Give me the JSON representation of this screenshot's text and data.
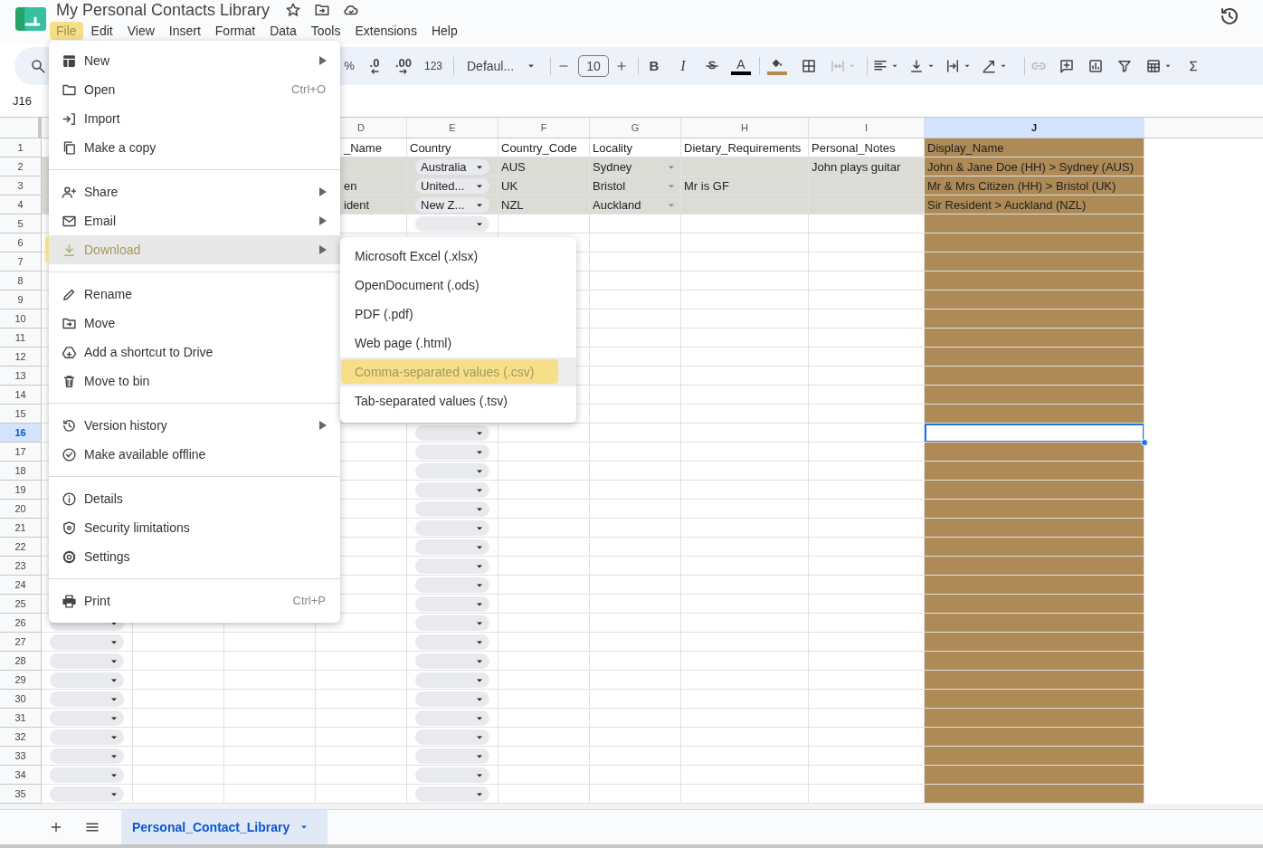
{
  "header": {
    "title": "My Personal Contacts Library"
  },
  "menubar": [
    {
      "label": "File",
      "selected": true
    },
    {
      "label": "Edit",
      "selected": false
    },
    {
      "label": "View",
      "selected": false
    },
    {
      "label": "Insert",
      "selected": false
    },
    {
      "label": "Format",
      "selected": false
    },
    {
      "label": "Data",
      "selected": false
    },
    {
      "label": "Tools",
      "selected": false
    },
    {
      "label": "Extensions",
      "selected": false
    },
    {
      "label": "Help",
      "selected": false
    }
  ],
  "toolbar": {
    "percent": "%",
    "decrease_decimal": ".0",
    "increase_decimal": ".00",
    "number_format": "123",
    "font": "Defaul...",
    "font_size": "10",
    "bold": "B",
    "italic": "I",
    "text_color": {
      "label": "A",
      "color": "#000000"
    },
    "fill_color": {
      "color": "#b8894f"
    },
    "merge": {
      "disabled": true
    },
    "link": {
      "disabled": true
    }
  },
  "name_box": "J16",
  "grid": {
    "columns": [
      {
        "label": "D",
        "selected": false
      },
      {
        "label": "E",
        "selected": false
      },
      {
        "label": "F",
        "selected": false
      },
      {
        "label": "G",
        "selected": false
      },
      {
        "label": "H",
        "selected": false
      },
      {
        "label": "I",
        "selected": false
      },
      {
        "label": "J",
        "selected": true,
        "color": "#ad8a56"
      }
    ],
    "rows": [
      {
        "number": "1",
        "selected": false,
        "shaded": false,
        "cells": [
          null,
          null,
          null,
          {
            "text": "_Name"
          },
          {
            "text": "Country"
          },
          {
            "text": "Country_Code"
          },
          {
            "text": "Locality"
          },
          {
            "text": "Dietary_Requirements"
          },
          {
            "text": "Personal_Notes"
          },
          {
            "text": "Display_Name"
          }
        ]
      },
      {
        "number": "2",
        "selected": false,
        "shaded": true,
        "cells": [
          null,
          null,
          null,
          null,
          {
            "kind": "chip",
            "text": "Australia"
          },
          {
            "text": "AUS"
          },
          {
            "kind": "arrow",
            "text": "Sydney"
          },
          null,
          {
            "text": "John plays guitar"
          },
          {
            "text": "John & Jane Doe (HH) > Sydney (AUS)"
          }
        ]
      },
      {
        "number": "3",
        "selected": false,
        "shaded": true,
        "cells": [
          null,
          null,
          null,
          {
            "text": "en"
          },
          {
            "kind": "chip",
            "text": "United..."
          },
          {
            "text": "UK"
          },
          {
            "kind": "arrow",
            "text": "Bristol"
          },
          {
            "text": "Mr is GF"
          },
          null,
          {
            "text": "Mr & Mrs Citizen (HH) > Bristol (UK)"
          }
        ]
      },
      {
        "number": "4",
        "selected": false,
        "shaded": true,
        "cells": [
          null,
          null,
          null,
          {
            "text": "ident"
          },
          {
            "kind": "chip",
            "text": "New Z..."
          },
          {
            "text": "NZL"
          },
          {
            "kind": "arrow",
            "text": "Auckland"
          },
          null,
          null,
          {
            "text": "Sir Resident > Auckland (NZL)"
          }
        ]
      },
      {
        "number": "5",
        "selected": false,
        "shaded": false,
        "cells": [
          null,
          null,
          null,
          null,
          {
            "kind": "chip"
          }
        ]
      },
      {
        "number": "6",
        "selected": false,
        "shaded": false
      },
      {
        "number": "7",
        "selected": false,
        "shaded": false
      },
      {
        "number": "8",
        "selected": false,
        "shaded": false
      },
      {
        "number": "9",
        "selected": false,
        "shaded": false
      },
      {
        "number": "10",
        "selected": false,
        "shaded": false
      },
      {
        "number": "11",
        "selected": false,
        "shaded": false
      },
      {
        "number": "12",
        "selected": false,
        "shaded": false
      },
      {
        "number": "13",
        "selected": false,
        "shaded": false
      },
      {
        "number": "14",
        "selected": false,
        "shaded": false
      },
      {
        "number": "15",
        "selected": false,
        "shaded": false
      },
      {
        "number": "16",
        "selected": true,
        "shaded": false,
        "cells": [
          null,
          null,
          null,
          null,
          {
            "kind": "chip"
          }
        ]
      },
      {
        "number": "17",
        "selected": false,
        "shaded": false,
        "cells": [
          null,
          null,
          null,
          null,
          {
            "kind": "chip"
          }
        ]
      },
      {
        "number": "18",
        "selected": false,
        "shaded": false,
        "cells": [
          null,
          null,
          null,
          null,
          {
            "kind": "chip"
          }
        ]
      },
      {
        "number": "19",
        "selected": false,
        "shaded": false,
        "cells": [
          null,
          null,
          null,
          null,
          {
            "kind": "chip"
          }
        ]
      },
      {
        "number": "20",
        "selected": false,
        "shaded": false,
        "cells": [
          null,
          null,
          null,
          null,
          {
            "kind": "chip"
          }
        ]
      },
      {
        "number": "21",
        "selected": false,
        "shaded": false,
        "cells": [
          null,
          null,
          null,
          null,
          {
            "kind": "chip"
          }
        ]
      },
      {
        "number": "22",
        "selected": false,
        "shaded": false,
        "cells": [
          null,
          null,
          null,
          null,
          {
            "kind": "chip"
          }
        ]
      },
      {
        "number": "23",
        "selected": false,
        "shaded": false,
        "cells": [
          null,
          null,
          null,
          null,
          {
            "kind": "chip"
          }
        ]
      },
      {
        "number": "24",
        "selected": false,
        "shaded": false,
        "cells": [
          null,
          null,
          null,
          null,
          {
            "kind": "chip"
          }
        ]
      },
      {
        "number": "25",
        "selected": false,
        "shaded": false,
        "cells": [
          null,
          null,
          null,
          null,
          {
            "kind": "chip"
          }
        ]
      },
      {
        "number": "26",
        "selected": false,
        "shaded": false,
        "cells": [
          {
            "kind": "chip"
          },
          null,
          null,
          null,
          {
            "kind": "chip"
          }
        ]
      },
      {
        "number": "27",
        "selected": false,
        "shaded": false,
        "cells": [
          {
            "kind": "chip"
          },
          null,
          null,
          null,
          {
            "kind": "chip"
          }
        ]
      },
      {
        "number": "28",
        "selected": false,
        "shaded": false,
        "cells": [
          {
            "kind": "chip"
          },
          null,
          null,
          null,
          {
            "kind": "chip"
          }
        ]
      },
      {
        "number": "29",
        "selected": false,
        "shaded": false,
        "cells": [
          {
            "kind": "chip"
          },
          null,
          null,
          null,
          {
            "kind": "chip"
          }
        ]
      },
      {
        "number": "30",
        "selected": false,
        "shaded": false,
        "cells": [
          {
            "kind": "chip"
          },
          null,
          null,
          null,
          {
            "kind": "chip"
          }
        ]
      },
      {
        "number": "31",
        "selected": false,
        "shaded": false,
        "cells": [
          {
            "kind": "chip"
          },
          null,
          null,
          null,
          {
            "kind": "chip"
          }
        ]
      },
      {
        "number": "32",
        "selected": false,
        "shaded": false,
        "cells": [
          {
            "kind": "chip"
          },
          null,
          null,
          null,
          {
            "kind": "chip"
          }
        ]
      },
      {
        "number": "33",
        "selected": false,
        "shaded": false,
        "cells": [
          {
            "kind": "chip"
          },
          null,
          null,
          null,
          {
            "kind": "chip"
          }
        ]
      },
      {
        "number": "34",
        "selected": false,
        "shaded": false,
        "cells": [
          {
            "kind": "chip"
          },
          null,
          null,
          null,
          {
            "kind": "chip"
          }
        ]
      },
      {
        "number": "35",
        "selected": false,
        "shaded": false,
        "cells": [
          {
            "kind": "chip"
          },
          null,
          null,
          null,
          {
            "kind": "chip"
          }
        ]
      }
    ]
  },
  "sheet_tabs": [
    {
      "label": "Personal_Contact_Library",
      "selected": true
    }
  ],
  "file_menu": {
    "items": [
      {
        "kind": "item",
        "label": "New",
        "submenu": true,
        "selected": false
      },
      {
        "kind": "item",
        "label": "Open",
        "shortcut": "Ctrl+O",
        "selected": false
      },
      {
        "kind": "item",
        "label": "Import",
        "selected": false
      },
      {
        "kind": "item",
        "label": "Make a copy",
        "selected": false
      },
      {
        "kind": "divider"
      },
      {
        "kind": "item",
        "label": "Share",
        "submenu": true,
        "selected": false
      },
      {
        "kind": "item",
        "label": "Email",
        "submenu": true,
        "selected": false
      },
      {
        "kind": "item",
        "label": "Download",
        "submenu": true,
        "selected": true
      },
      {
        "kind": "divider"
      },
      {
        "kind": "item",
        "label": "Rename",
        "selected": false
      },
      {
        "kind": "item",
        "label": "Move",
        "selected": false
      },
      {
        "kind": "item",
        "label": "Add a shortcut to Drive",
        "selected": false
      },
      {
        "kind": "item",
        "label": "Move to bin",
        "selected": false
      },
      {
        "kind": "divider"
      },
      {
        "kind": "item",
        "label": "Version history",
        "submenu": true,
        "selected": false
      },
      {
        "kind": "item",
        "label": "Make available offline",
        "selected": false
      },
      {
        "kind": "divider"
      },
      {
        "kind": "item",
        "label": "Details",
        "selected": false
      },
      {
        "kind": "item",
        "label": "Security limitations",
        "selected": false
      },
      {
        "kind": "item",
        "label": "Settings",
        "selected": false
      },
      {
        "kind": "divider"
      },
      {
        "kind": "item",
        "label": "Print",
        "shortcut": "Ctrl+P",
        "selected": false
      }
    ]
  },
  "download_submenu": {
    "items": [
      {
        "label": "Microsoft Excel (.xlsx)",
        "selected": false
      },
      {
        "label": "OpenDocument (.ods)",
        "selected": false
      },
      {
        "label": "PDF (.pdf)",
        "selected": false
      },
      {
        "label": "Web page (.html)",
        "selected": false
      },
      {
        "label": "Comma-separated values (.csv)",
        "selected": true
      },
      {
        "label": "Tab-separated values (.tsv)",
        "selected": false
      }
    ]
  }
}
